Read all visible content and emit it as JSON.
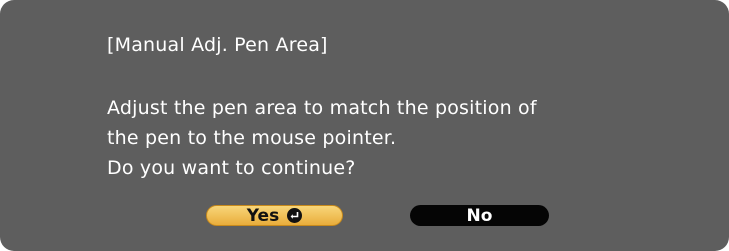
{
  "dialog": {
    "title": "[Manual Adj. Pen Area]",
    "message_lines": [
      "Adjust the pen area to match the position of",
      "the pen to the mouse pointer.",
      "Do you want to continue?"
    ]
  },
  "buttons": {
    "yes_label": "Yes",
    "yes_icon": "enter-key-icon",
    "no_label": "No"
  },
  "colors": {
    "dialog_background": "#5e5e5e",
    "text": "#ffffff",
    "selected_button": "#f0be52",
    "unselected_button": "#050505"
  }
}
